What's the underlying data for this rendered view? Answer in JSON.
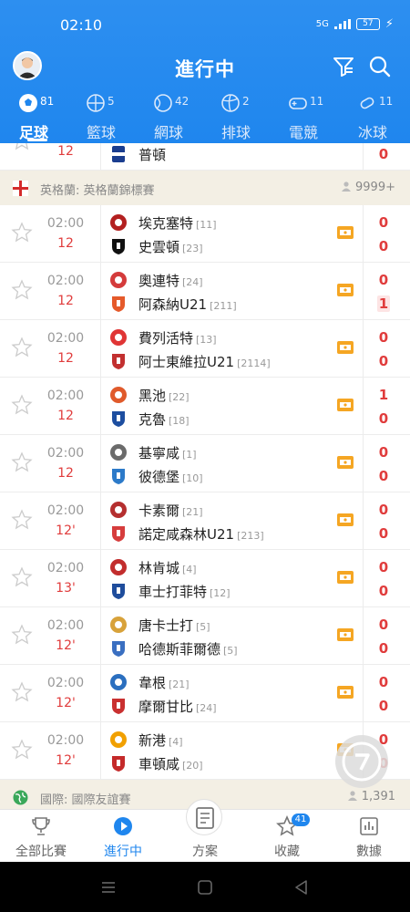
{
  "status_bar": {
    "time": "02:10",
    "signal": "5G",
    "battery": "57"
  },
  "header": {
    "title": "進行中"
  },
  "sport_tabs": [
    {
      "label": "足球",
      "count": "81",
      "icon": "soccer-ball-icon",
      "active": true
    },
    {
      "label": "籃球",
      "count": "5",
      "icon": "basketball-icon",
      "active": false
    },
    {
      "label": "網球",
      "count": "42",
      "icon": "tennis-ball-icon",
      "active": false
    },
    {
      "label": "排球",
      "count": "2",
      "icon": "volleyball-icon",
      "active": false
    },
    {
      "label": "電競",
      "count": "11",
      "icon": "gamepad-icon",
      "active": false
    },
    {
      "label": "冰球",
      "count": "11",
      "icon": "hockey-puck-icon",
      "active": false
    }
  ],
  "partial_match": {
    "minute": "12",
    "away_team": "普頓",
    "away_score": "0"
  },
  "league": {
    "name": "英格蘭: 英格蘭錦標賽",
    "viewers": "9999+"
  },
  "matches": [
    {
      "time": "02:00",
      "minute": "12",
      "home": "埃克塞特",
      "home_rank": "[11]",
      "away": "史雲頓",
      "away_rank": "[23]",
      "home_score": "0",
      "away_score": "0",
      "hl": ""
    },
    {
      "time": "02:00",
      "minute": "12",
      "home": "奧連特",
      "home_rank": "[24]",
      "away": "阿森納U21",
      "away_rank": "[211]",
      "home_score": "0",
      "away_score": "1",
      "hl": "away"
    },
    {
      "time": "02:00",
      "minute": "12",
      "home": "費列活特",
      "home_rank": "[13]",
      "away": "阿士東維拉U21",
      "away_rank": "[2114]",
      "home_score": "0",
      "away_score": "0",
      "hl": ""
    },
    {
      "time": "02:00",
      "minute": "12",
      "home": "黑池",
      "home_rank": "[22]",
      "away": "克魯",
      "away_rank": "[18]",
      "home_score": "1",
      "away_score": "0",
      "hl": ""
    },
    {
      "time": "02:00",
      "minute": "12",
      "home": "基寧咸",
      "home_rank": "[1]",
      "away": "彼德堡",
      "away_rank": "[10]",
      "home_score": "0",
      "away_score": "0",
      "hl": ""
    },
    {
      "time": "02:00",
      "minute": "12'",
      "home": "卡素爾",
      "home_rank": "[21]",
      "away": "諾定咸森林U21",
      "away_rank": "[213]",
      "home_score": "0",
      "away_score": "0",
      "hl": ""
    },
    {
      "time": "02:00",
      "minute": "13'",
      "home": "林肯城",
      "home_rank": "[4]",
      "away": "車士打菲特",
      "away_rank": "[12]",
      "home_score": "0",
      "away_score": "0",
      "hl": ""
    },
    {
      "time": "02:00",
      "minute": "12'",
      "home": "唐卡士打",
      "home_rank": "[5]",
      "away": "哈德斯菲爾德",
      "away_rank": "[5]",
      "home_score": "0",
      "away_score": "0",
      "hl": ""
    },
    {
      "time": "02:00",
      "minute": "12'",
      "home": "韋根",
      "home_rank": "[21]",
      "away": "摩爾甘比",
      "away_rank": "[24]",
      "home_score": "0",
      "away_score": "0",
      "hl": ""
    },
    {
      "time": "02:00",
      "minute": "12'",
      "home": "新港",
      "home_rank": "[4]",
      "away": "車頓咸",
      "away_rank": "[20]",
      "home_score": "0",
      "away_score": "0",
      "hl": ""
    }
  ],
  "league2": {
    "name": "國際: 國際友誼賽",
    "viewers": "1,391"
  },
  "bottom_nav": [
    {
      "label": "全部比賽",
      "icon": "trophy-icon",
      "active": false
    },
    {
      "label": "進行中",
      "icon": "play-circle-icon",
      "active": true
    },
    {
      "label": "方案",
      "icon": "document-icon",
      "active": false
    },
    {
      "label": "收藏",
      "icon": "star-icon",
      "active": false,
      "badge": "41"
    },
    {
      "label": "數據",
      "icon": "bar-chart-icon",
      "active": false
    }
  ],
  "colors": {
    "primary": "#1f86ee",
    "score_red": "#e03c3c",
    "league_bg": "#f3efe4"
  }
}
